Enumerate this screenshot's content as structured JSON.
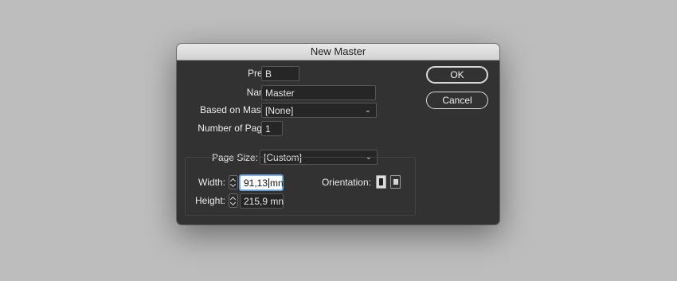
{
  "dialog": {
    "title": "New Master",
    "prefix": {
      "label": "Prefix:",
      "value": "B"
    },
    "name": {
      "label": "Name:",
      "value": "Master"
    },
    "based_on": {
      "label": "Based on Master:",
      "value": "[None]"
    },
    "num_pages": {
      "label": "Number of Pages:",
      "value": "1"
    },
    "page_size": {
      "label": "Page Size:",
      "value": "[Custom]"
    },
    "width": {
      "label": "Width:",
      "value_before_cursor": "91,13",
      "value_after_cursor": "mn"
    },
    "height": {
      "label": "Height:",
      "value": "215,9 mn"
    },
    "orientation": {
      "label": "Orientation:",
      "selected": "portrait"
    },
    "buttons": {
      "ok": "OK",
      "cancel": "Cancel"
    }
  },
  "icons": [
    "chevron-down-icon",
    "stepper-icon",
    "portrait-orientation-icon",
    "landscape-orientation-icon"
  ]
}
